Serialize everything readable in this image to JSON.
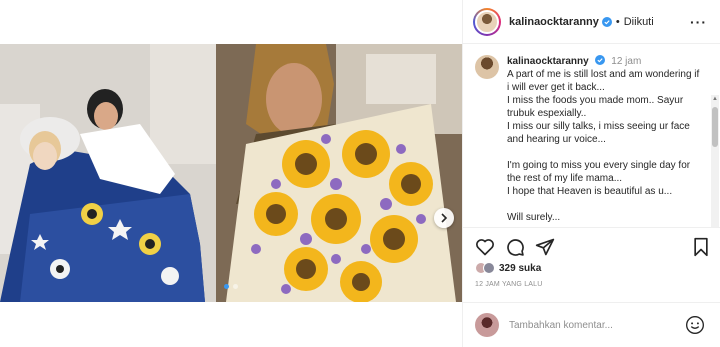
{
  "post": {
    "username": "kalinaocktaranny",
    "follow_state": "Diikuti",
    "separator": "•",
    "more_label": "···",
    "caption_time": "12 jam",
    "caption_lines": [
      "A part of me is still lost and am wondering if i will ever get it back...",
      "I miss the foods you made mom.. Sayur trubuk espexially..",
      "I miss our silly talks, i miss seeing ur face and hearing ur voice...",
      "",
      "I'm going to miss you every single day for the rest of my life mama...",
      "I hope that Heaven is beautiful as u...",
      "",
      "Will surely..."
    ],
    "likes_label": "329 suka",
    "timestamp": "12 JAM YANG LALU",
    "comment_placeholder": "Tambahkan komentar...",
    "carousel": {
      "total": 2,
      "current": 1
    }
  },
  "icons": {
    "verified": "verified-badge-icon",
    "like": "heart-icon",
    "comment": "comment-icon",
    "share": "send-icon",
    "save": "bookmark-icon",
    "emoji": "emoji-icon",
    "next": "chevron-right-icon"
  },
  "colors": {
    "verified_blue": "#3897f0",
    "text": "#262626",
    "muted": "#8e8e8e",
    "border": "#efefef"
  }
}
